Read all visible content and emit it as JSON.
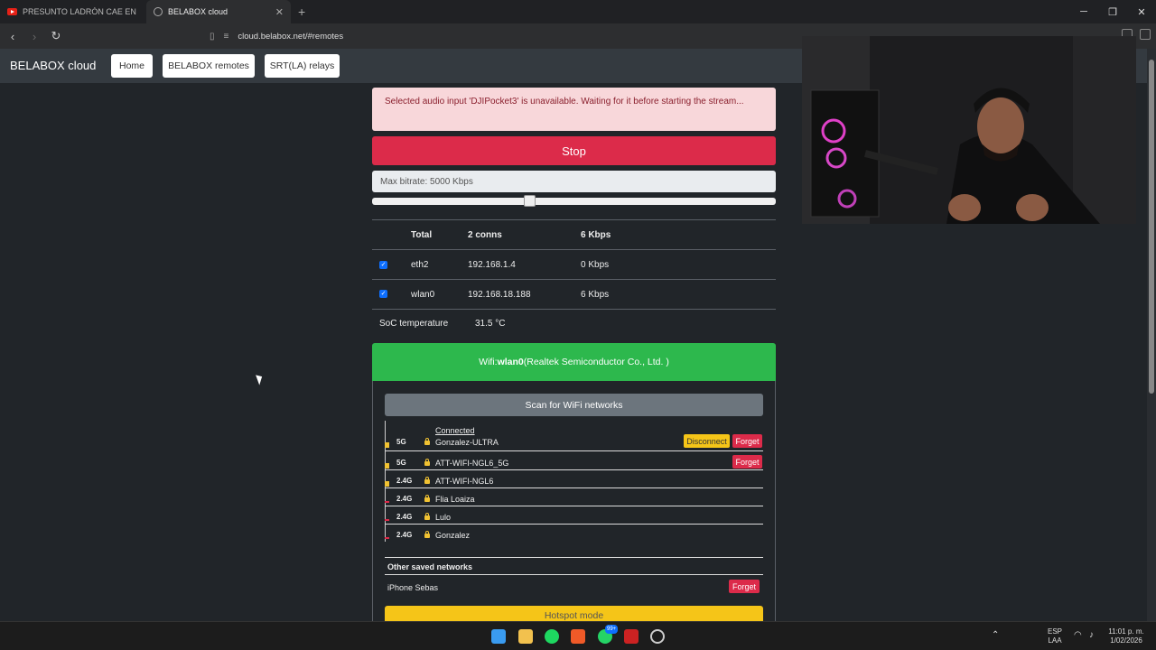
{
  "browser": {
    "tabs": [
      {
        "title": "PRESUNTO LADRÓN CAE EN FLAG",
        "active": false
      },
      {
        "title": "BELABOX cloud",
        "active": true
      }
    ],
    "url": "cloud.belabox.net/#remotes"
  },
  "navbar": {
    "brand": "BELABOX cloud",
    "buttons": [
      "Home",
      "BELABOX remotes",
      "SRT(LA) relays"
    ]
  },
  "alert": "Selected audio input 'DJIPocket3' is unavailable. Waiting for it before starting the stream...",
  "stop_label": "Stop",
  "bitrate": {
    "label": "Max bitrate: 5000 Kbps",
    "slider_fraction": 0.39
  },
  "conns": {
    "total": {
      "name": "Total",
      "conns": "2 conns",
      "rate": "6 Kbps"
    },
    "rows": [
      {
        "iface": "eth2",
        "ip": "192.168.1.4",
        "rate": "0 Kbps",
        "checked": true
      },
      {
        "iface": "wlan0",
        "ip": "192.168.18.188",
        "rate": "6 Kbps",
        "checked": true
      }
    ]
  },
  "soc": {
    "label": "SoC temperature",
    "value": "31.5 °C"
  },
  "wifi": {
    "prefix": "Wifi: ",
    "iface": "wlan0",
    "vendor": " (Realtek Semiconductor Co., Ltd. )",
    "scan_label": "Scan for WiFi networks",
    "connected_label": "Connected",
    "networks": [
      {
        "band": "5G",
        "ssid": "Gonzalez-ULTRA",
        "connected": true,
        "disconnect": "Disconnect",
        "forget": "Forget"
      },
      {
        "band": "5G",
        "ssid": "ATT-WIFI-NGL6_5G",
        "forget": "Forget"
      },
      {
        "band": "2.4G",
        "ssid": "ATT-WIFI-NGL6"
      },
      {
        "band": "2.4G",
        "ssid": "Flia Loaiza"
      },
      {
        "band": "2.4G",
        "ssid": "Lulo"
      },
      {
        "band": "2.4G",
        "ssid": "Gonzalez"
      }
    ],
    "other_saved_label": "Other saved networks",
    "other_saved": [
      {
        "ssid": "iPhone Sebas",
        "forget": "Forget"
      }
    ],
    "hotspot_label": "Hotspot mode"
  },
  "tray": {
    "lang1": "ESP",
    "lang2": "LAA",
    "time": "11:01 p. m.",
    "date": "1/02/2026",
    "badge": "99+"
  }
}
